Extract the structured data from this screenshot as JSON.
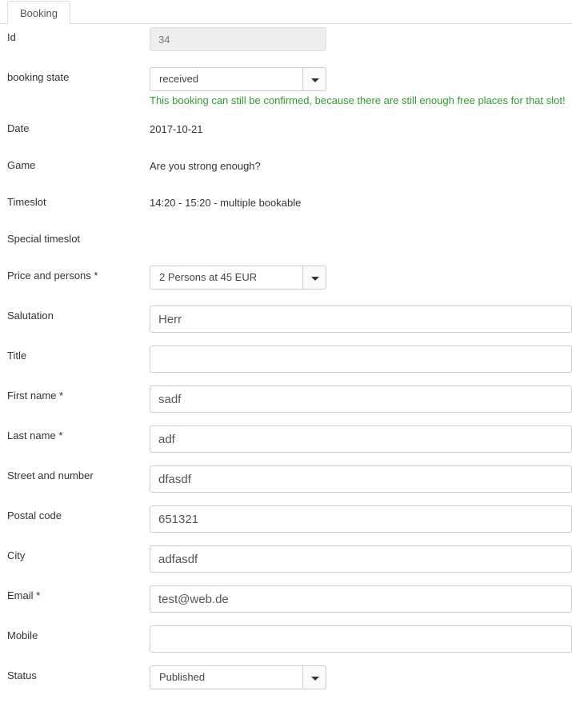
{
  "tabs": [
    {
      "label": "Booking",
      "active": true
    }
  ],
  "colors": {
    "help_green": "#2e9c2e",
    "label": "#333333",
    "border": "#cccccc",
    "readonly_bg": "#eeeeee"
  },
  "form": {
    "rows": [
      {
        "id": "id",
        "label": "Id",
        "type": "readonly-input",
        "value": "34"
      },
      {
        "id": "booking-state",
        "label": "booking state",
        "type": "select",
        "value": "received",
        "help": "This booking can still be confirmed, because there are still enough free places for that slot!"
      },
      {
        "id": "date",
        "label": "Date",
        "type": "static",
        "value": "2017-10-21"
      },
      {
        "id": "game",
        "label": "Game",
        "type": "static",
        "value": "Are you strong enough?"
      },
      {
        "id": "timeslot",
        "label": "Timeslot",
        "type": "static",
        "value": "14:20 - 15:20 - multiple bookable"
      },
      {
        "id": "special-timeslot",
        "label": "Special timeslot",
        "type": "static",
        "value": ""
      },
      {
        "id": "price-and-persons",
        "label": "Price and persons *",
        "type": "select",
        "value": "2 Persons at 45 EUR"
      },
      {
        "id": "salutation",
        "label": "Salutation",
        "type": "input",
        "value": "Herr"
      },
      {
        "id": "title",
        "label": "Title",
        "type": "input",
        "value": ""
      },
      {
        "id": "first-name",
        "label": "First name *",
        "type": "input",
        "value": "sadf"
      },
      {
        "id": "last-name",
        "label": "Last name *",
        "type": "input",
        "value": "adf"
      },
      {
        "id": "street-and-number",
        "label": "Street and number",
        "type": "input",
        "value": "dfasdf"
      },
      {
        "id": "postal-code",
        "label": "Postal code",
        "type": "input",
        "value": "651321"
      },
      {
        "id": "city",
        "label": "City",
        "type": "input",
        "value": "adfasdf"
      },
      {
        "id": "email",
        "label": "Email *",
        "type": "input",
        "value": "test@web.de"
      },
      {
        "id": "mobile",
        "label": "Mobile",
        "type": "input",
        "value": ""
      },
      {
        "id": "status",
        "label": "Status",
        "type": "select",
        "value": "Published"
      }
    ]
  },
  "icons": {
    "caret_down": "chevron-down-icon"
  }
}
